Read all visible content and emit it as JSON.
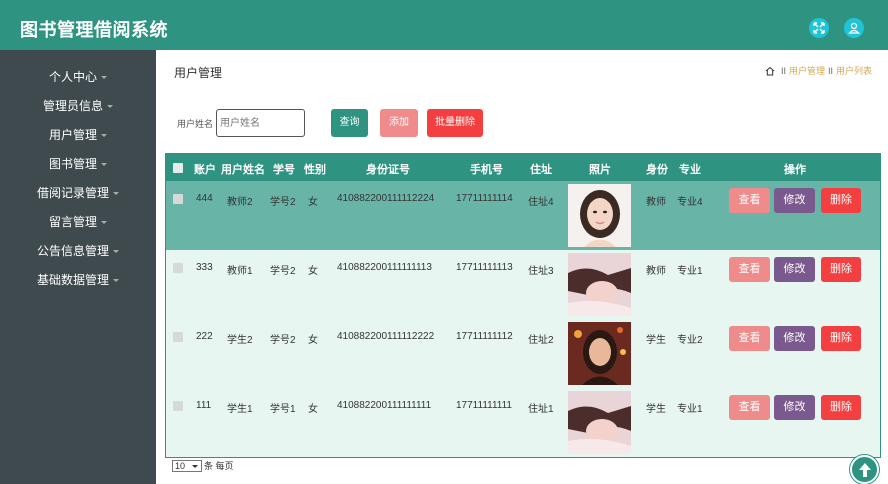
{
  "header": {
    "title": "图书管理借阅系统"
  },
  "sidebar": {
    "items": [
      {
        "label": "个人中心"
      },
      {
        "label": "管理员信息"
      },
      {
        "label": "用户管理"
      },
      {
        "label": "图书管理"
      },
      {
        "label": "借阅记录管理"
      },
      {
        "label": "留言管理"
      },
      {
        "label": "公告信息管理"
      },
      {
        "label": "基础数据管理"
      }
    ]
  },
  "page": {
    "title": "用户管理",
    "breadcrumb": {
      "sep": "II",
      "level1": "用户管理",
      "level2": "用户列表"
    }
  },
  "search": {
    "label": "用户姓名",
    "placeholder": "用户姓名",
    "query_label": "查询",
    "add_label": "添加",
    "batch_delete_label": "批量删除"
  },
  "table": {
    "headers": {
      "account": "账户",
      "username": "用户姓名",
      "student_no": "学号",
      "gender": "性别",
      "id_card": "身份证号",
      "phone": "手机号",
      "address": "住址",
      "photo": "照片",
      "identity": "身份",
      "major": "专业",
      "actions": "操作"
    },
    "action_labels": {
      "view": "查看",
      "edit": "修改",
      "delete": "删除"
    },
    "rows": [
      {
        "account": "444",
        "username": "教师2",
        "student_no": "学号2",
        "gender": "女",
        "id_card": "410882200111112224",
        "phone": "17711111114",
        "address": "住址4",
        "identity": "教师",
        "major": "专业4"
      },
      {
        "account": "333",
        "username": "教师1",
        "student_no": "学号2",
        "gender": "女",
        "id_card": "410882200111111113",
        "phone": "17711111113",
        "address": "住址3",
        "identity": "教师",
        "major": "专业1"
      },
      {
        "account": "222",
        "username": "学生2",
        "student_no": "学号2",
        "gender": "女",
        "id_card": "410882200111112222",
        "phone": "17711111112",
        "address": "住址2",
        "identity": "学生",
        "major": "专业2"
      },
      {
        "account": "111",
        "username": "学生1",
        "student_no": "学号1",
        "gender": "女",
        "id_card": "410882200111111111",
        "phone": "17711111111",
        "address": "住址1",
        "identity": "学生",
        "major": "专业1"
      }
    ]
  },
  "pagination": {
    "page_size": "10",
    "suffix": "条 每页"
  },
  "colors": {
    "primary": "#2e9381",
    "sidebar": "#3f4a4f",
    "highlight_row": "#68b5a8",
    "view": "#f08b8b",
    "edit": "#7a5a8e",
    "delete": "#f33f3f",
    "breadcrumb_link": "#d4a84e"
  }
}
